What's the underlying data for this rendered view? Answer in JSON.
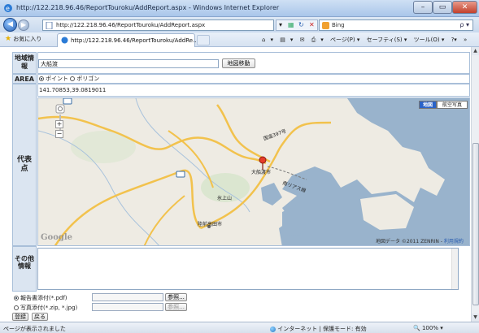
{
  "window": {
    "title": "http://122.218.96.46/ReportTouroku/AddReport.aspx - Windows Internet Explorer",
    "min_label": "–",
    "max_label": "▭",
    "close_label": "✕"
  },
  "address_bar": {
    "url": "http://122.218.96.46/ReportTouroku/AddReport.aspx",
    "search_provider": "Bing",
    "search_glyph": "ρ ▾"
  },
  "command_bar": {
    "favorites_label": "お気に入り",
    "tab_title": "http://122.218.96.46/ReportTouroku/AddRe...",
    "commands": [
      "▾",
      "▾",
      "▾",
      "ページ(P) ▾",
      "セーフティ(S) ▾",
      "ツール(O) ▾",
      "?▾",
      "»"
    ]
  },
  "form": {
    "region_label": "地域情報",
    "region_value": "大船渡",
    "map_move_button": "地図移動",
    "area_label": "AREA",
    "area_options": [
      {
        "label": "ポイント",
        "checked": true
      },
      {
        "label": "ポリゴン",
        "checked": false
      }
    ],
    "coordinates": "141.70853,39.0819011",
    "representative_label": "代表点",
    "other_label": "その他情報",
    "attachments": [
      {
        "label": "報告書添付(*.pdf)",
        "checked": true,
        "browse": "参照..."
      },
      {
        "label": "写真添付(*.zip, *.jpg)",
        "checked": false,
        "browse": "参照..."
      }
    ],
    "register_button": "登録",
    "back_button": "戻る"
  },
  "map": {
    "type_map": "地図",
    "type_satellite": "航空写真",
    "google": "Google",
    "copyright": "地図データ ©2011 ZENRIN -",
    "terms": "利用規約",
    "places": [
      "大船渡市",
      "氷上山",
      "陸前高田市",
      "南リアス線",
      "国道397号"
    ],
    "zoom_in": "+",
    "zoom_out": "−"
  },
  "status_bar": {
    "status": "ページが表示されました",
    "zone": "インターネット | 保護モード: 有効",
    "zoom": "100%"
  }
}
